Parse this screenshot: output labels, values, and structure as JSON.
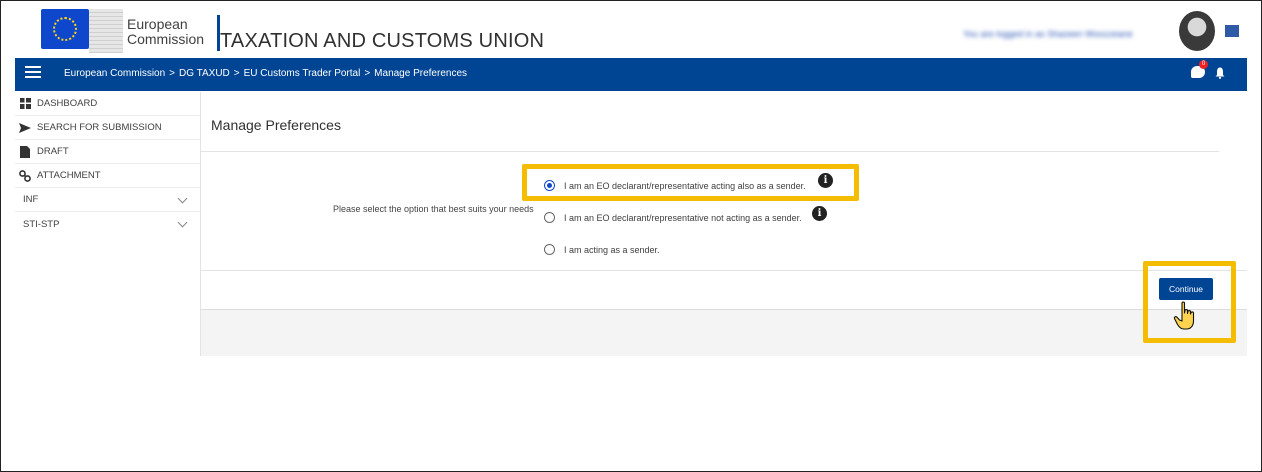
{
  "header": {
    "logo_line1": "European",
    "logo_line2": "Commission",
    "site_title": "TAXATION AND CUSTOMS UNION",
    "user_text": "You are logged in as Shazeen Woozzeane"
  },
  "navbar": {
    "breadcrumbs": [
      "European Commission",
      "DG TAXUD",
      "EU Customs Trader Portal",
      "Manage Preferences"
    ],
    "separator": ">",
    "notification_count": "0"
  },
  "sidebar": {
    "items": [
      {
        "label": "DASHBOARD",
        "icon": "dashboard-icon"
      },
      {
        "label": "SEARCH FOR SUBMISSION",
        "icon": "send-icon"
      },
      {
        "label": "DRAFT",
        "icon": "file-icon"
      },
      {
        "label": "ATTACHMENT",
        "icon": "link-icon"
      },
      {
        "label": "INF",
        "icon": "",
        "expandable": true
      },
      {
        "label": "STI-STP",
        "icon": "",
        "expandable": true
      }
    ]
  },
  "main": {
    "page_title": "Manage Preferences",
    "prompt": "Please select the option that best suits your needs",
    "options": [
      {
        "label": "I am an EO declarant/representative acting also as a sender.",
        "checked": true,
        "info": true
      },
      {
        "label": "I am an EO declarant/representative not acting as a sender.",
        "checked": false,
        "info": true
      },
      {
        "label": "I am acting as a sender.",
        "checked": false,
        "info": false
      }
    ],
    "continue_label": "Continue"
  },
  "colors": {
    "brand_blue": "#004494",
    "highlight": "#f5bd02",
    "radio_selected": "#0e47cb"
  }
}
